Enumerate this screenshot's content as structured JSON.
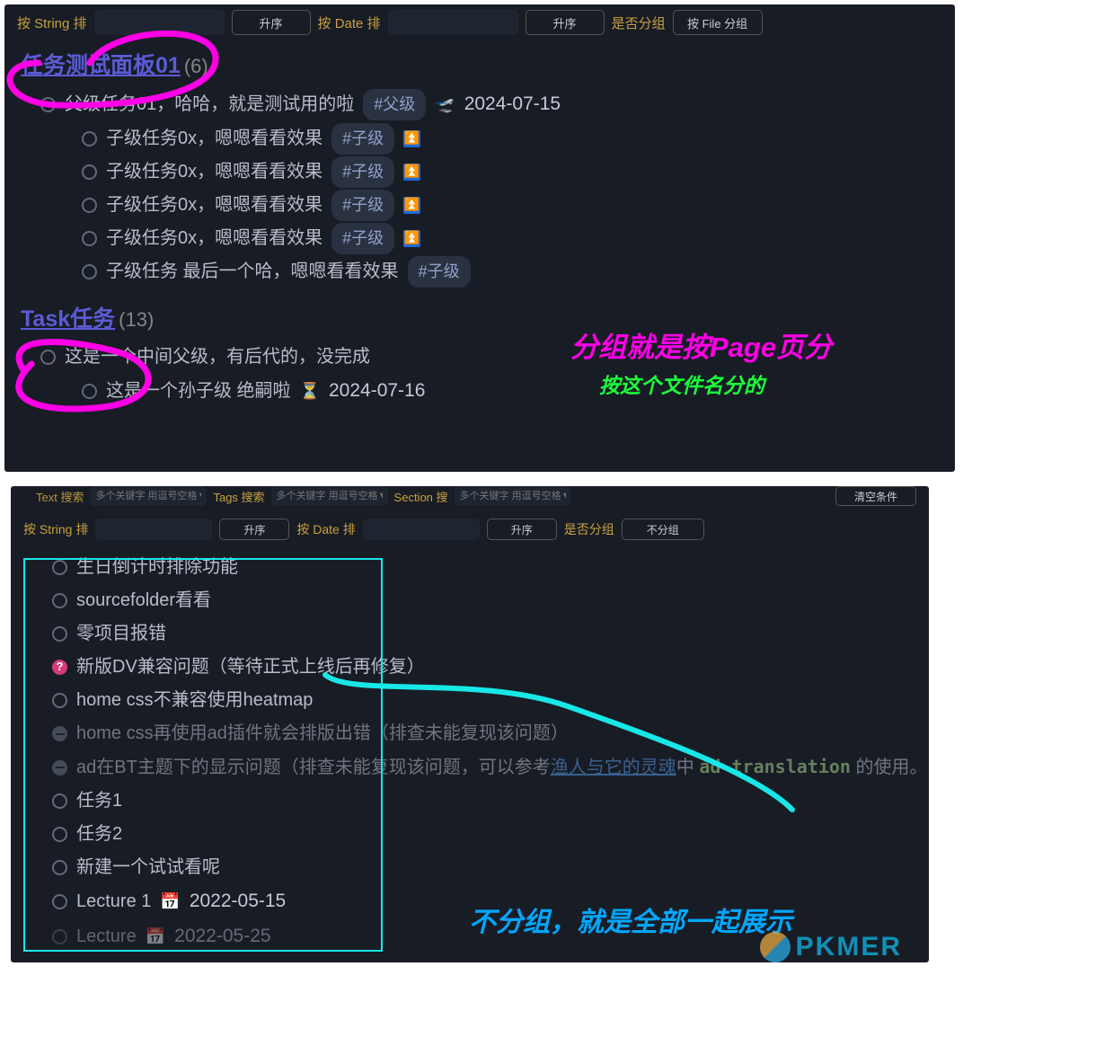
{
  "toolbar1": {
    "sort_string_label": "按 String 排",
    "sort_string_btn": "升序",
    "sort_date_label": "按 Date 排",
    "sort_date_btn": "升序",
    "group_label": "是否分组",
    "group_btn": "按 File 分组"
  },
  "group1": {
    "title": "任务测试面板01",
    "count": "(6)",
    "parent": "父级任务01，哈哈，就是测试用的啦",
    "parent_tag": "#父级",
    "airplane": "🛫",
    "parent_date": "2024-07-15",
    "children": [
      {
        "text": "子级任务0x，嗯嗯看看效果",
        "tag": "#子级",
        "prio": "⏫"
      },
      {
        "text": "子级任务0x，嗯嗯看看效果",
        "tag": "#子级",
        "prio": "⏫"
      },
      {
        "text": "子级任务0x，嗯嗯看看效果",
        "tag": "#子级",
        "prio": "⏫"
      },
      {
        "text": "子级任务0x，嗯嗯看看效果",
        "tag": "#子级",
        "prio": "⏫"
      },
      {
        "text": "子级任务 最后一个哈，嗯嗯看看效果",
        "tag": "#子级",
        "prio": ""
      }
    ]
  },
  "group2": {
    "title": "Task任务",
    "count": "(13)",
    "row1": "这是一个中间父级，有后代的，没完成",
    "row2": "这是一个孙子级 绝嗣啦",
    "row2_emoji": "⏳",
    "row2_date": "2024-07-16"
  },
  "anno_top_1": "分组就是按Page页分",
  "anno_top_2": "按这个文件名分的",
  "cut_toolbar": {
    "text_label": "Text 搜索",
    "tags_label": "Tags 搜索",
    "section_label": "Section 搜",
    "placeholder": "多个关键字 用逗号空格▼",
    "clear_btn": "清空条件"
  },
  "toolbar2": {
    "sort_string_label": "按 String 排",
    "sort_string_btn": "升序",
    "sort_date_label": "按 Date 排",
    "sort_date_btn": "升序",
    "group_label": "是否分组",
    "group_btn": "不分组"
  },
  "flat": {
    "items": [
      {
        "kind": "c",
        "text": "生日倒计时排除功能"
      },
      {
        "kind": "c",
        "text": "sourcefolder看看"
      },
      {
        "kind": "c",
        "text": "零项目报错"
      },
      {
        "kind": "q",
        "text": "新版DV兼容问题（等待正式上线后再修复）"
      },
      {
        "kind": "c",
        "text": "home css不兼容使用heatmap"
      },
      {
        "kind": "d",
        "text": "home css再使用ad插件就会排版出错（排查未能复现该问题）"
      },
      {
        "kind": "d",
        "composite": true,
        "t1": "ad在BT主题下的显示问题（排查未能复现该问题，可以参考",
        "link": "渔人与它的灵魂",
        "t2": "中 ",
        "code": "ad-translation",
        "t3": " 的使用。"
      },
      {
        "kind": "c",
        "text": "任务1"
      },
      {
        "kind": "c",
        "text": "任务2"
      },
      {
        "kind": "c",
        "text": "新建一个试试看呢"
      },
      {
        "kind": "c",
        "text": "Lecture 1",
        "emoji": "📅",
        "date": "2022-05-15"
      },
      {
        "kind": "c",
        "text": "Lecture",
        "emoji": "📅",
        "date": "2022-05-25",
        "cut": true
      }
    ]
  },
  "anno_bottom": "不分组，就是全部一起展示",
  "watermark": "PKMER"
}
